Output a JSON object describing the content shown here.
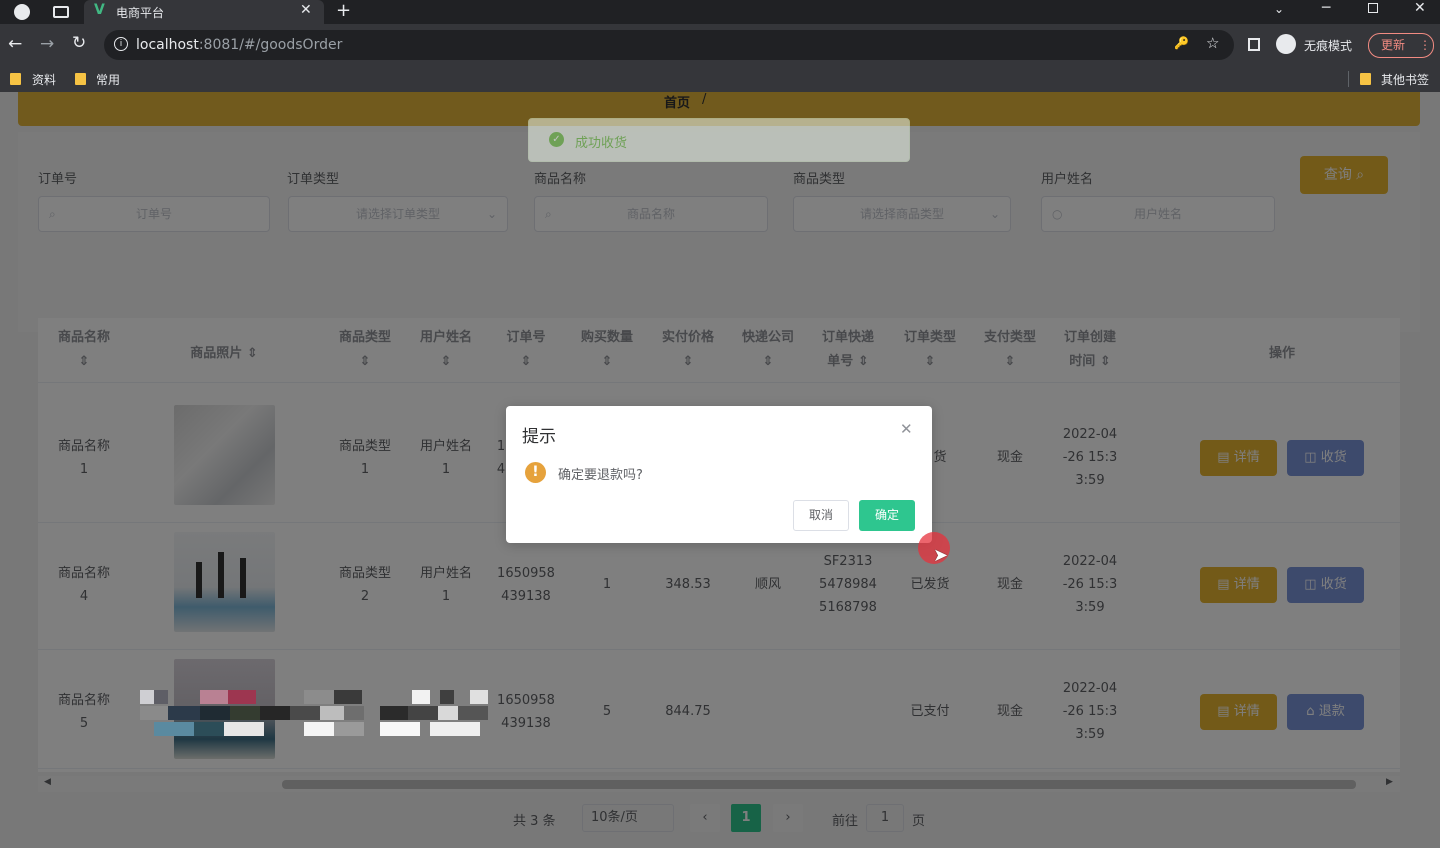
{
  "browser": {
    "tab_title": "电商平台",
    "url_host": "localhost",
    "url_rest": ":8081/#/goodsOrder",
    "incognito_label": "无痕模式",
    "update_label": "更新",
    "bookmarks": [
      "资料",
      "常用"
    ],
    "other_bookmarks": "其他书签"
  },
  "breadcrumb": {
    "home": "首页",
    "sep": "/"
  },
  "toast": {
    "text": "成功收货"
  },
  "search": {
    "fields": [
      {
        "label": "订单号",
        "placeholder": "订单号"
      },
      {
        "label": "订单类型",
        "placeholder": "请选择订单类型"
      },
      {
        "label": "商品名称",
        "placeholder": "商品名称"
      },
      {
        "label": "商品类型",
        "placeholder": "请选择商品类型"
      },
      {
        "label": "用户姓名",
        "placeholder": "用户姓名"
      }
    ],
    "query_label": "查询"
  },
  "table": {
    "headers": {
      "goods_name": "商品名称",
      "photo": "商品照片",
      "goods_type": "商品类型",
      "user_name": "用户姓名",
      "order_no": "订单号",
      "qty": "购买数量",
      "price": "实付价格",
      "courier": "快递公司",
      "tracking_1": "订单快递",
      "tracking_2": "单号",
      "order_type": "订单类型",
      "pay_type": "支付类型",
      "created_1": "订单创建",
      "created_2": "时间",
      "ops": "操作"
    },
    "rows": [
      {
        "goods_name_1": "商品名称",
        "goods_name_2": "1",
        "goods_type_1": "商品类型",
        "goods_type_2": "1",
        "user_1": "用户姓名",
        "user_2": "1",
        "order_1": "1",
        "order_2": "4",
        "qty": "",
        "price": "",
        "courier": "",
        "track_1": "",
        "track_2": "",
        "track_3": "",
        "order_type": "货",
        "pay": "现金",
        "created_1": "2022-04",
        "created_2": "-26 15:3",
        "created_3": "3:59",
        "detail": "详情",
        "action": "收货"
      },
      {
        "goods_name_1": "商品名称",
        "goods_name_2": "4",
        "goods_type_1": "商品类型",
        "goods_type_2": "2",
        "user_1": "用户姓名",
        "user_2": "1",
        "order_1": "1650958",
        "order_2": "439138",
        "qty": "1",
        "price": "348.53",
        "courier": "顺风",
        "track_1": "SF2313",
        "track_2": "5478984",
        "track_3": "5168798",
        "order_type": "已发货",
        "pay": "现金",
        "created_1": "2022-04",
        "created_2": "-26 15:3",
        "created_3": "3:59",
        "detail": "详情",
        "action": "收货"
      },
      {
        "goods_name_1": "商品名称",
        "goods_name_2": "5",
        "goods_type_1": "",
        "goods_type_2": "",
        "user_1": "",
        "user_2": "",
        "order_1": "1650958",
        "order_2": "439138",
        "qty": "5",
        "price": "844.75",
        "courier": "",
        "track_1": "",
        "track_2": "",
        "track_3": "",
        "order_type": "已支付",
        "pay": "现金",
        "created_1": "2022-04",
        "created_2": "-26 15:3",
        "created_3": "3:59",
        "detail": "详情",
        "action": "退款"
      }
    ]
  },
  "pagination": {
    "total": "共 3 条",
    "page_size": "10条/页",
    "current": "1",
    "goto_label": "前往",
    "goto_value": "1",
    "page_unit": "页"
  },
  "dialog": {
    "title": "提示",
    "message": "确定要退款吗?",
    "cancel": "取消",
    "confirm": "确定"
  },
  "colors": {
    "accent_yellow": "#e6b531",
    "blue_button": "#7b95d8",
    "confirm_green": "#2ec68f",
    "warning_orange": "#e6a23c"
  }
}
